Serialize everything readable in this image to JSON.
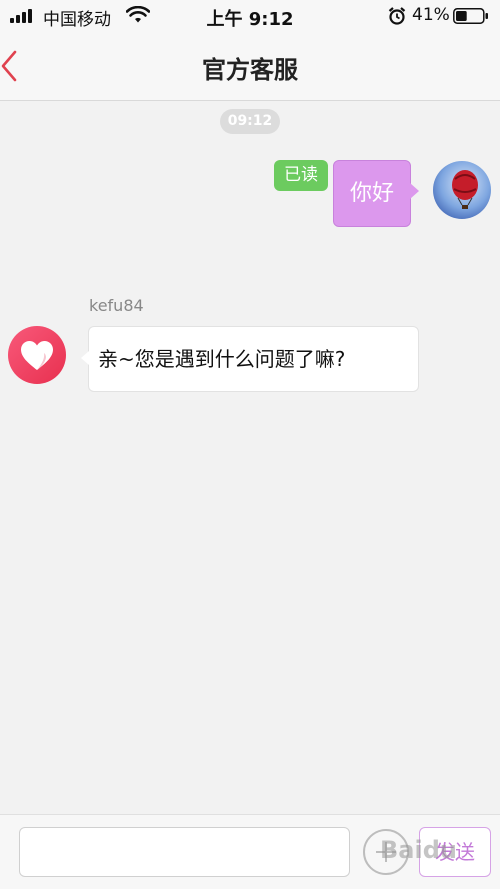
{
  "status_bar": {
    "carrier": "中国移动",
    "time": "上午 9:12",
    "battery_percent": "41%",
    "battery_level": 0.41
  },
  "nav": {
    "back_icon": "chevron-left-icon",
    "title": "官方客服"
  },
  "chat": {
    "timestamp": "09:12",
    "messages": [
      {
        "sender": "me",
        "text": "你好",
        "read_badge": "已读"
      },
      {
        "sender": "agent",
        "name": "kefu84",
        "text": "亲~您是遇到什么问题了嘛?"
      }
    ]
  },
  "input_bar": {
    "placeholder": "",
    "plus_icon": "plus-circle-icon",
    "send_label": "发送"
  },
  "watermark": "Baidu",
  "colors": {
    "accent": "#c37ad8",
    "my_bubble": "#dc98ed",
    "read_badge": "#6ccb5f",
    "back_arrow": "#e0424f"
  }
}
